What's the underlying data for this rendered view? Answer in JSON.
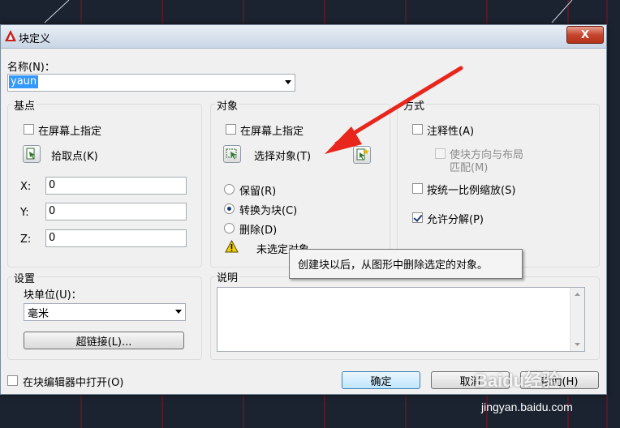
{
  "window": {
    "title": "块定义",
    "close_label": "X"
  },
  "name_field": {
    "label": "名称(N)：",
    "value": "yaun"
  },
  "base_point": {
    "title": "基点",
    "specify_on_screen": "在屏幕上指定",
    "pick_point": "拾取点(K)",
    "x_label": "X:",
    "x_value": "0",
    "y_label": "Y:",
    "y_value": "0",
    "z_label": "Z:",
    "z_value": "0"
  },
  "objects": {
    "title": "对象",
    "specify_on_screen": "在屏幕上指定",
    "select_objects": "选择对象(T)",
    "retain": "保留(R)",
    "convert_to_block": "转换为块(C)",
    "delete": "删除(D)",
    "selected_option": "convert_to_block",
    "status": "未选定对象"
  },
  "behavior": {
    "title": "方式",
    "annotative": "注释性(A)",
    "match_orientation": "使块方向与布局",
    "match_orientation_line2": "匹配(M)",
    "scale_uniformly": "按统一比例缩放(S)",
    "allow_exploding": "允许分解(P)",
    "allow_exploding_checked": true
  },
  "settings": {
    "title": "设置",
    "block_unit_label": "块单位(U)：",
    "block_unit_value": "毫米",
    "hyperlink": "超链接(L)..."
  },
  "description": {
    "title": "说明"
  },
  "tooltip": "创建块以后，从图形中删除选定的对象。",
  "open_in_block_editor": "在块编辑器中打开(O)",
  "buttons": {
    "ok": "确定",
    "cancel": "取消",
    "help": "帮助(H)"
  },
  "watermark": {
    "brand": "Baidu经验",
    "url": "jingyan.baidu.com"
  },
  "colors": {
    "annotation_arrow": "#e8261c",
    "cad_background": "#1c2330",
    "cad_grid": "#c0182a"
  },
  "icons": [
    "autocad-logo-icon",
    "pick-point-icon",
    "select-objects-icon",
    "quick-select-icon",
    "warning-icon"
  ]
}
